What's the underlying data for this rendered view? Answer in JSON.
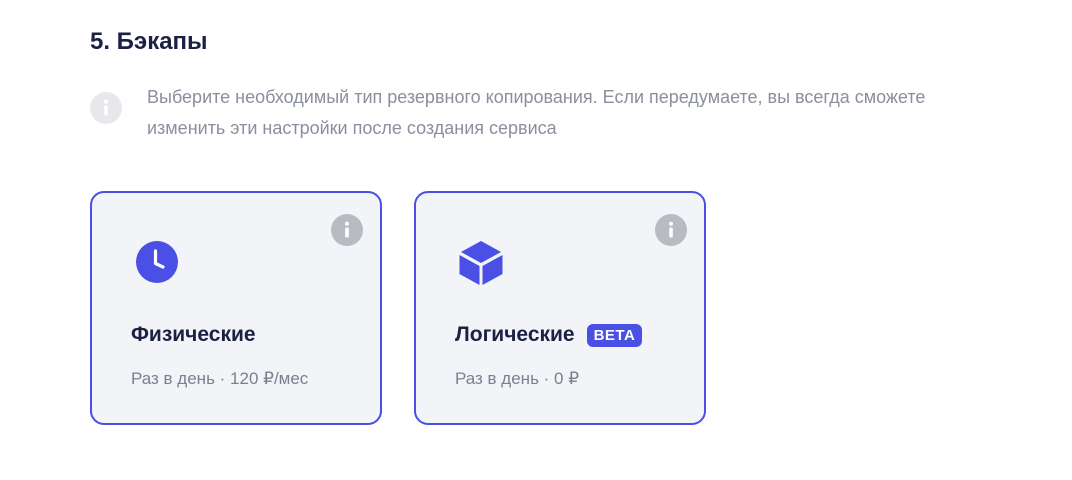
{
  "section": {
    "title": "5. Бэкапы",
    "info_text": "Выберите необходимый тип резервного копирования. Если передумаете, вы всегда сможете изменить эти настройки после создания сервиса"
  },
  "options": [
    {
      "title": "Физические",
      "subtitle": "Раз в день · 120 ₽/мес",
      "icon": "clock-icon",
      "selected": true
    },
    {
      "title": "Логические",
      "badge": "BETA",
      "subtitle": "Раз в день · 0 ₽",
      "icon": "cube-icon",
      "selected": true
    }
  ],
  "colors": {
    "accent": "#4a4fe6",
    "heading": "#1c2143",
    "muted_text": "#8a8e9e",
    "card_bg": "#f3f4f7",
    "info_icon": "#b9bbc3"
  }
}
